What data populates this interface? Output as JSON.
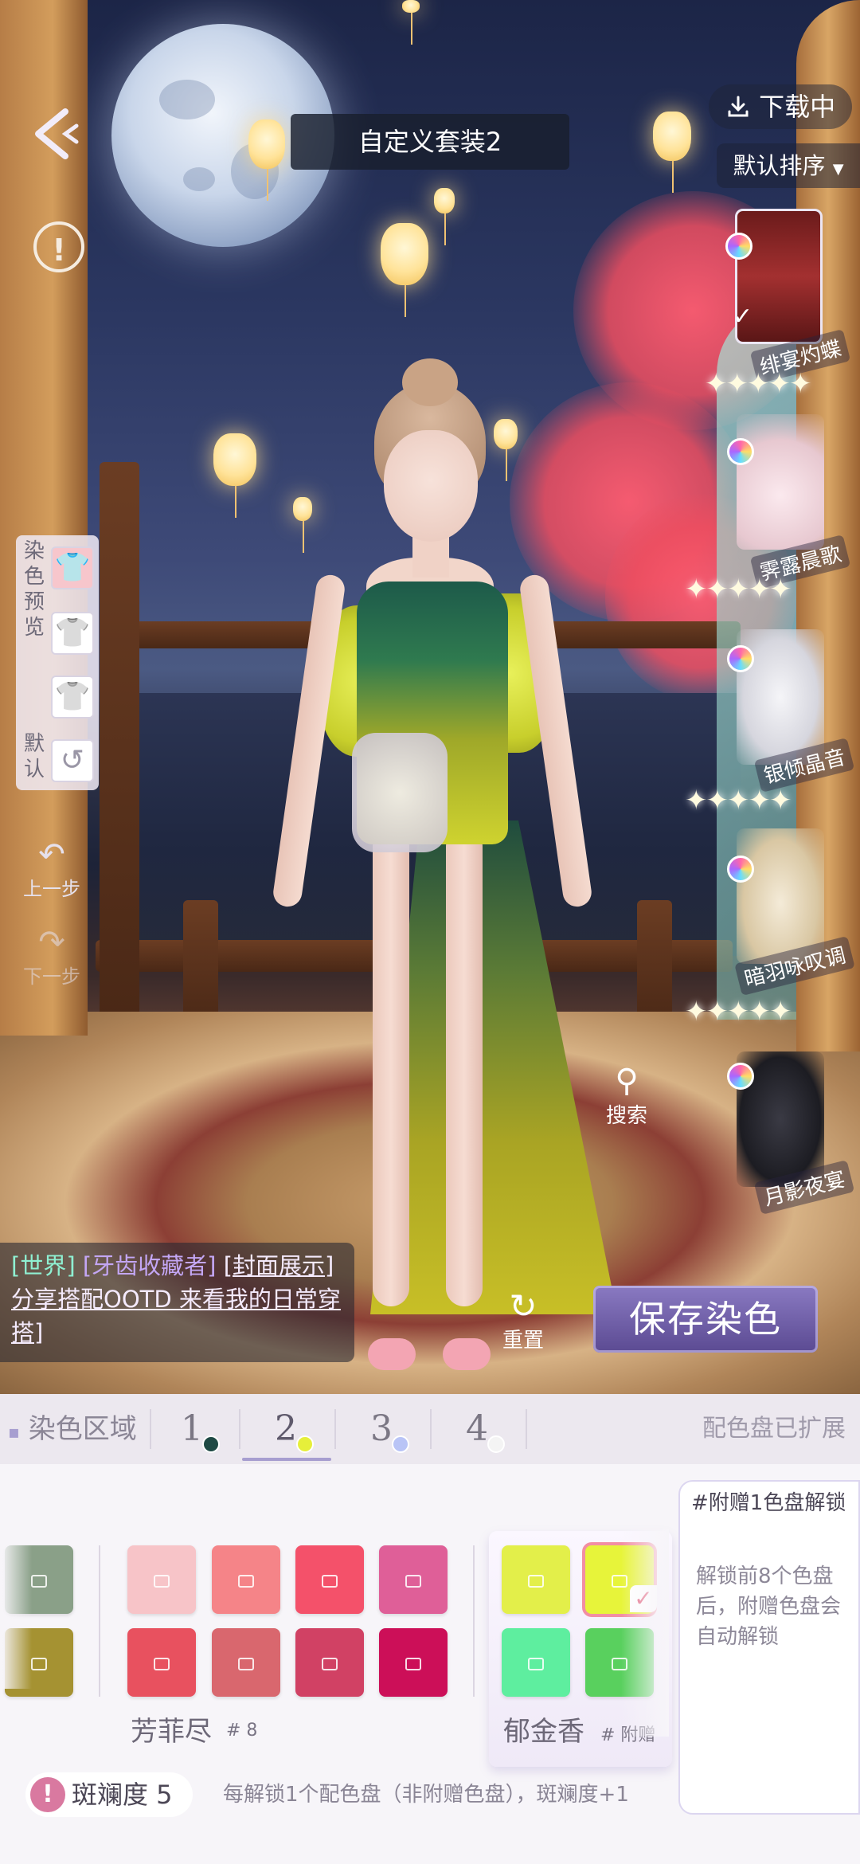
{
  "header": {
    "title": "自定义套装2",
    "download_label": "下载中",
    "sort_label": "默认排序"
  },
  "outfits": [
    {
      "name": "绯宴灼蝶",
      "stars": "✦✦✦✦✦"
    },
    {
      "name": "霁露晨歌",
      "stars": "✦✦✦✦✦"
    },
    {
      "name": "银倾晶音",
      "stars": "✦✦✦✦✦"
    },
    {
      "name": "暗羽咏叹调",
      "stars": "✦✦✦✦✦"
    },
    {
      "name": "月影夜宴",
      "stars": ""
    }
  ],
  "dye_preview": {
    "label_chars": [
      "染",
      "色",
      "预",
      "览"
    ],
    "default_chars": [
      "默",
      "认"
    ],
    "undo_label": "上一步",
    "redo_label": "下一步"
  },
  "chat": {
    "channel": "[世界]",
    "user": "[牙齿收藏者]",
    "message": "[封面展示]分享搭配OOTD 来看我的日常穿搭]"
  },
  "actions": {
    "search_label": "搜索",
    "reset_label": "重置",
    "save_label": "保存染色"
  },
  "dye_tabs": {
    "title": "染色区域",
    "tabs": [
      {
        "label": "1",
        "dot_color": "#1f4a45"
      },
      {
        "label": "2",
        "dot_color": "#e6ef3a"
      },
      {
        "label": "3",
        "dot_color": "#b9c4f6"
      },
      {
        "label": "4",
        "dot_color": "#f4f4f4"
      }
    ],
    "selected_tab": "2",
    "status": "配色盘已扩展"
  },
  "palettes": [
    {
      "name": "",
      "number": "",
      "colors": [
        "#8aa088",
        "#a59232"
      ]
    },
    {
      "name": "芳菲尽",
      "number": "# 8",
      "colors": [
        "#f7c4c8",
        "#f58488",
        "#f4516a",
        "#df5f98",
        "#e8515f",
        "#d9676e",
        "#d14164",
        "#cc0f58"
      ]
    },
    {
      "name": "郁金香",
      "number": "# 附赠",
      "colors": [
        "#e3ef4a",
        "#e7f43a",
        "#5eee9f",
        "#59d05e"
      ],
      "selected_index": 1
    }
  ],
  "unlock": {
    "title": "#附赠1色盘解锁",
    "description": "解锁前8个色盘后，附赠色盘会自动解锁"
  },
  "footer": {
    "label": "斑斓度 5",
    "note": "每解锁1个配色盘（非附赠色盘），斑斓度+1"
  },
  "colors": {
    "accent": "#a79ed0",
    "save_button": "#6f5fae",
    "warn": "#d979a0"
  }
}
